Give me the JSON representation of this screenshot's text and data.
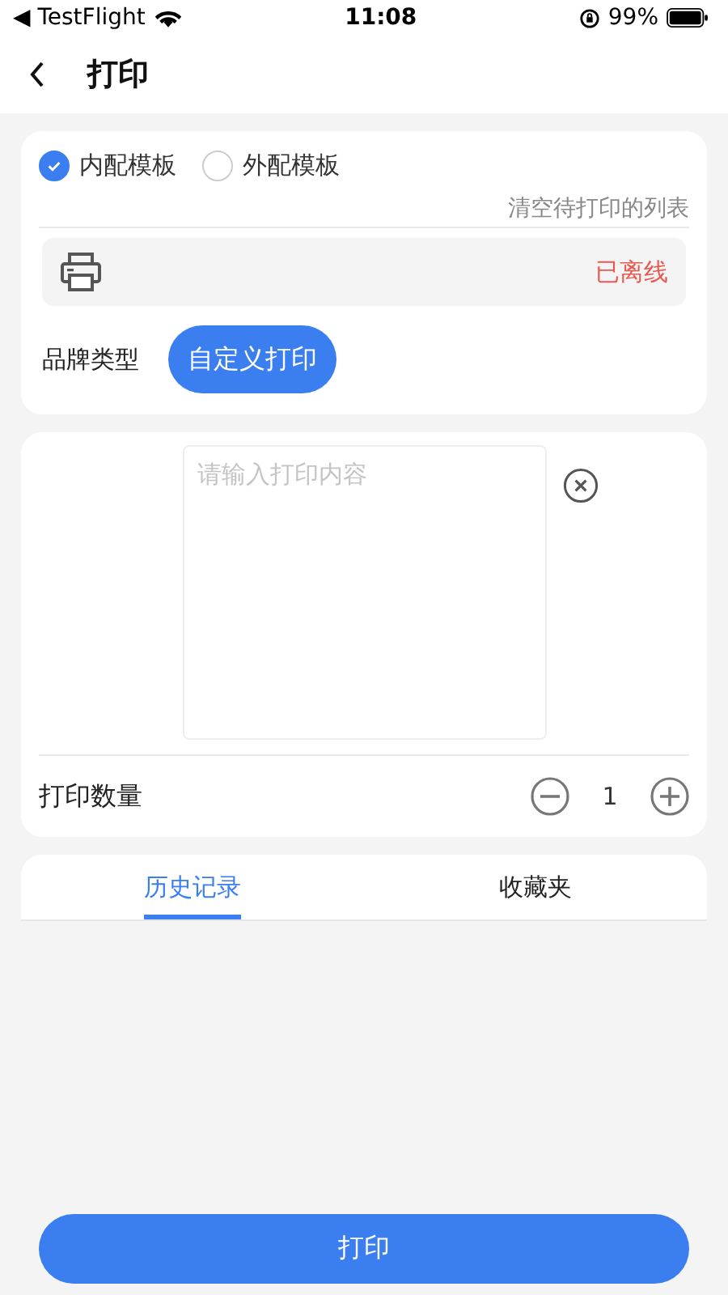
{
  "status_bar": {
    "back_app": "◀ TestFlight",
    "time": "11:08",
    "battery": "99%"
  },
  "nav": {
    "title": "打印"
  },
  "templates": [
    {
      "label": "内配模板",
      "selected": true
    },
    {
      "label": "外配模板",
      "selected": false
    }
  ],
  "clear_link": "清空待打印的列表",
  "printer": {
    "status": "已离线"
  },
  "brand": {
    "label": "品牌类型",
    "button": "自定义打印"
  },
  "content": {
    "placeholder": "请输入打印内容"
  },
  "quantity": {
    "label": "打印数量",
    "value": "1"
  },
  "tabs": [
    {
      "label": "历史记录",
      "selected": true
    },
    {
      "label": "收藏夹",
      "selected": false
    }
  ],
  "print_button": "打印"
}
